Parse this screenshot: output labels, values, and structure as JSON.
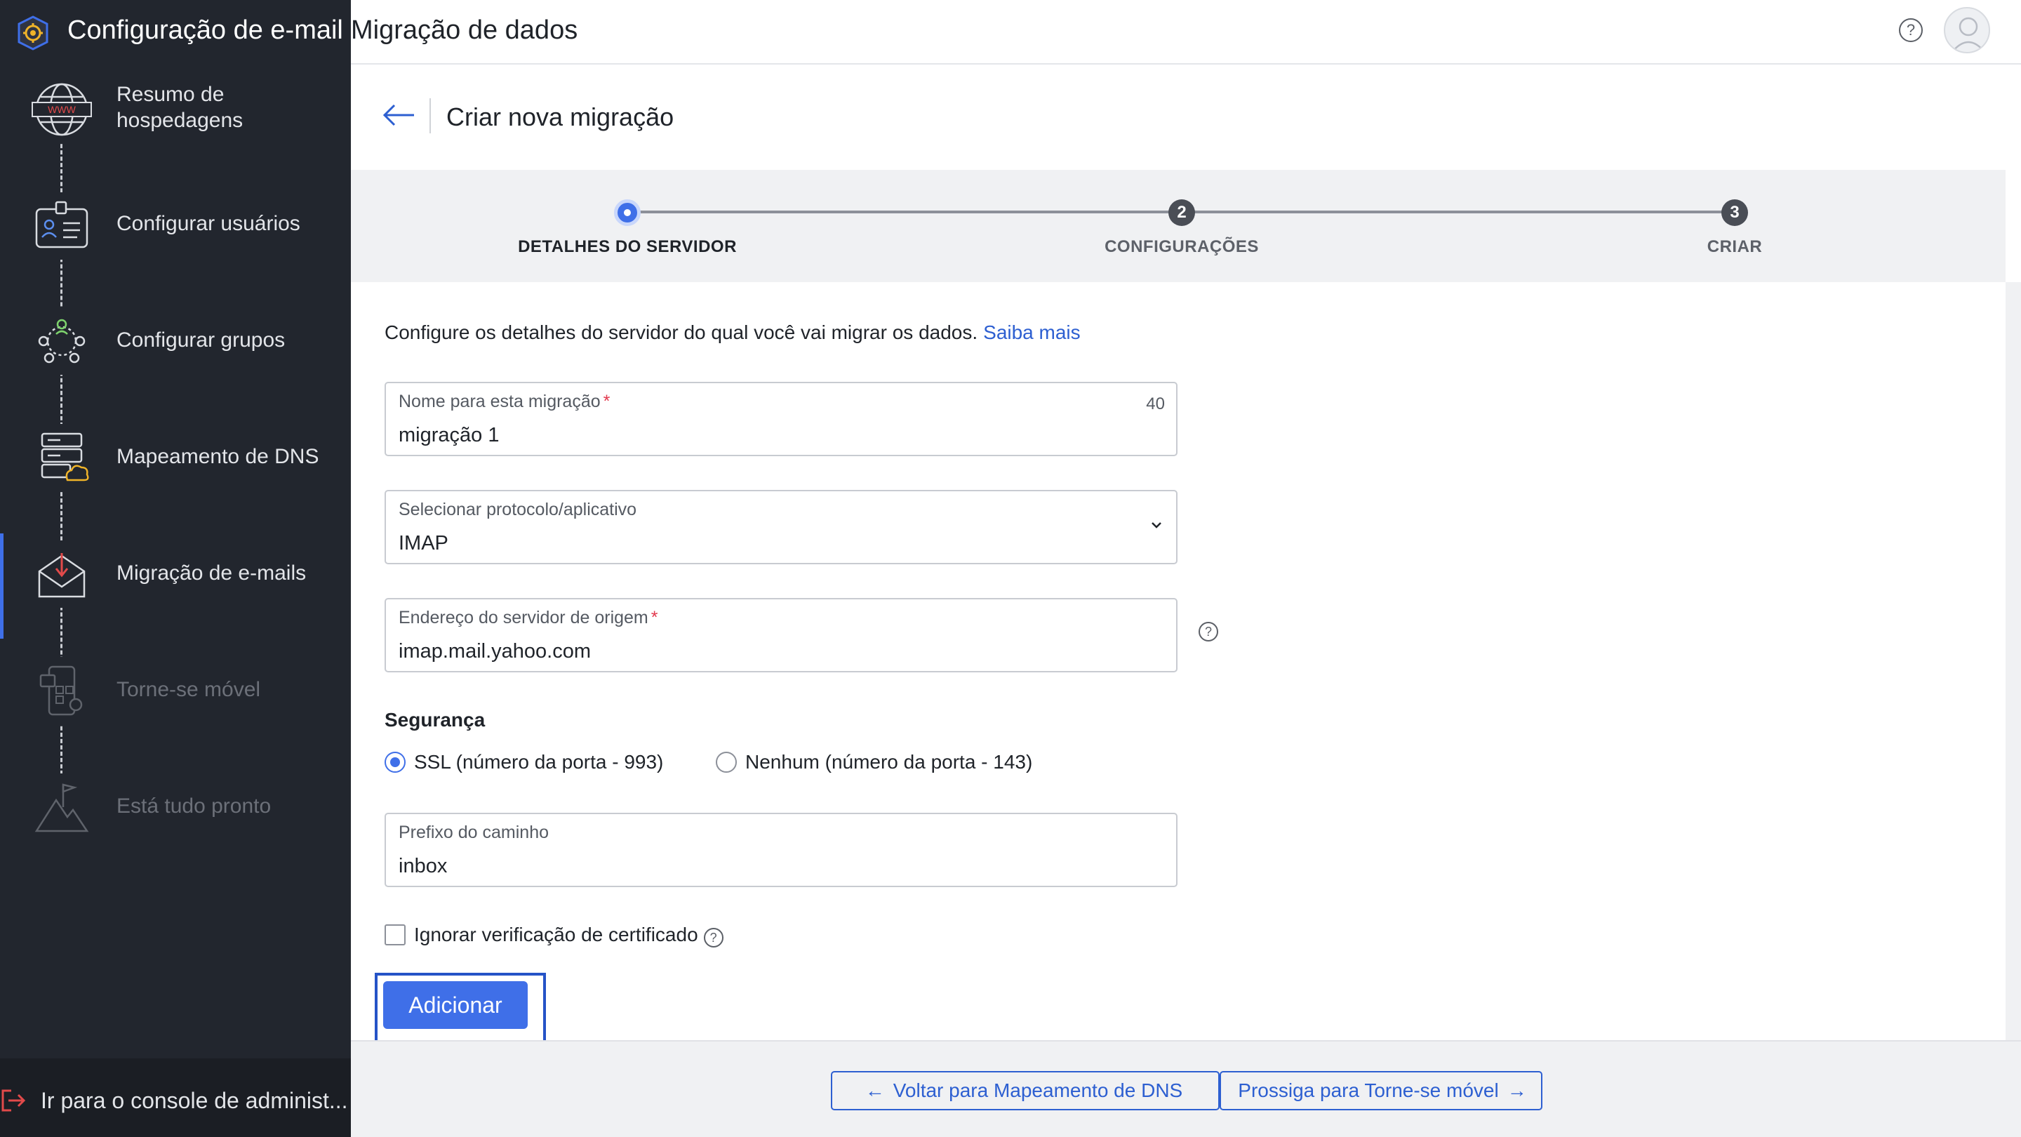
{
  "app": {
    "title": "Configuração de e-mail"
  },
  "sidebar": {
    "items": [
      {
        "label": "Resumo de hospedagens",
        "state": "done"
      },
      {
        "label": "Configurar usuários",
        "state": "done"
      },
      {
        "label": "Configurar grupos",
        "state": "done"
      },
      {
        "label": "Mapeamento de DNS",
        "state": "done"
      },
      {
        "label": "Migração de e-mails",
        "state": "active"
      },
      {
        "label": "Torne-se móvel",
        "state": "disabled"
      },
      {
        "label": "Está tudo pronto",
        "state": "disabled"
      }
    ],
    "console_link": "Ir para o console de administ..."
  },
  "topbar": {
    "title": "Migração de dados"
  },
  "page": {
    "title": "Criar nova migração"
  },
  "stepper": {
    "steps": [
      {
        "number": "1",
        "label": "DETALHES DO SERVIDOR",
        "state": "current"
      },
      {
        "number": "2",
        "label": "CONFIGURAÇÕES",
        "state": "todo"
      },
      {
        "number": "3",
        "label": "CRIAR",
        "state": "todo"
      }
    ]
  },
  "form": {
    "intro": "Configure os detalhes do servidor do qual você vai migrar os dados.",
    "learn_more": "Saiba mais",
    "name_field": {
      "label": "Nome para esta migração",
      "required_mark": "*",
      "value": "migração 1",
      "counter": "40"
    },
    "protocol_field": {
      "label": "Selecionar protocolo/aplicativo",
      "value": "IMAP"
    },
    "server_field": {
      "label": "Endereço do servidor de origem",
      "required_mark": "*",
      "value": "imap.mail.yahoo.com"
    },
    "security": {
      "title": "Segurança",
      "options": [
        {
          "label": "SSL (número da porta - 993)",
          "selected": true
        },
        {
          "label": "Nenhum (número da porta - 143)",
          "selected": false
        }
      ]
    },
    "path_field": {
      "label": "Prefixo do caminho",
      "value": "inbox"
    },
    "ignore_cert": {
      "label": "Ignorar verificação de certificado",
      "checked": false
    },
    "add_button": "Adicionar"
  },
  "footer": {
    "back_button": "Voltar para Mapeamento de DNS",
    "next_button": "Prossiga para Torne-se móvel"
  },
  "colors": {
    "sidebar_bg": "#22262e",
    "accent": "#3f6fe8",
    "link": "#2d5fd1",
    "required": "#e2384d"
  }
}
